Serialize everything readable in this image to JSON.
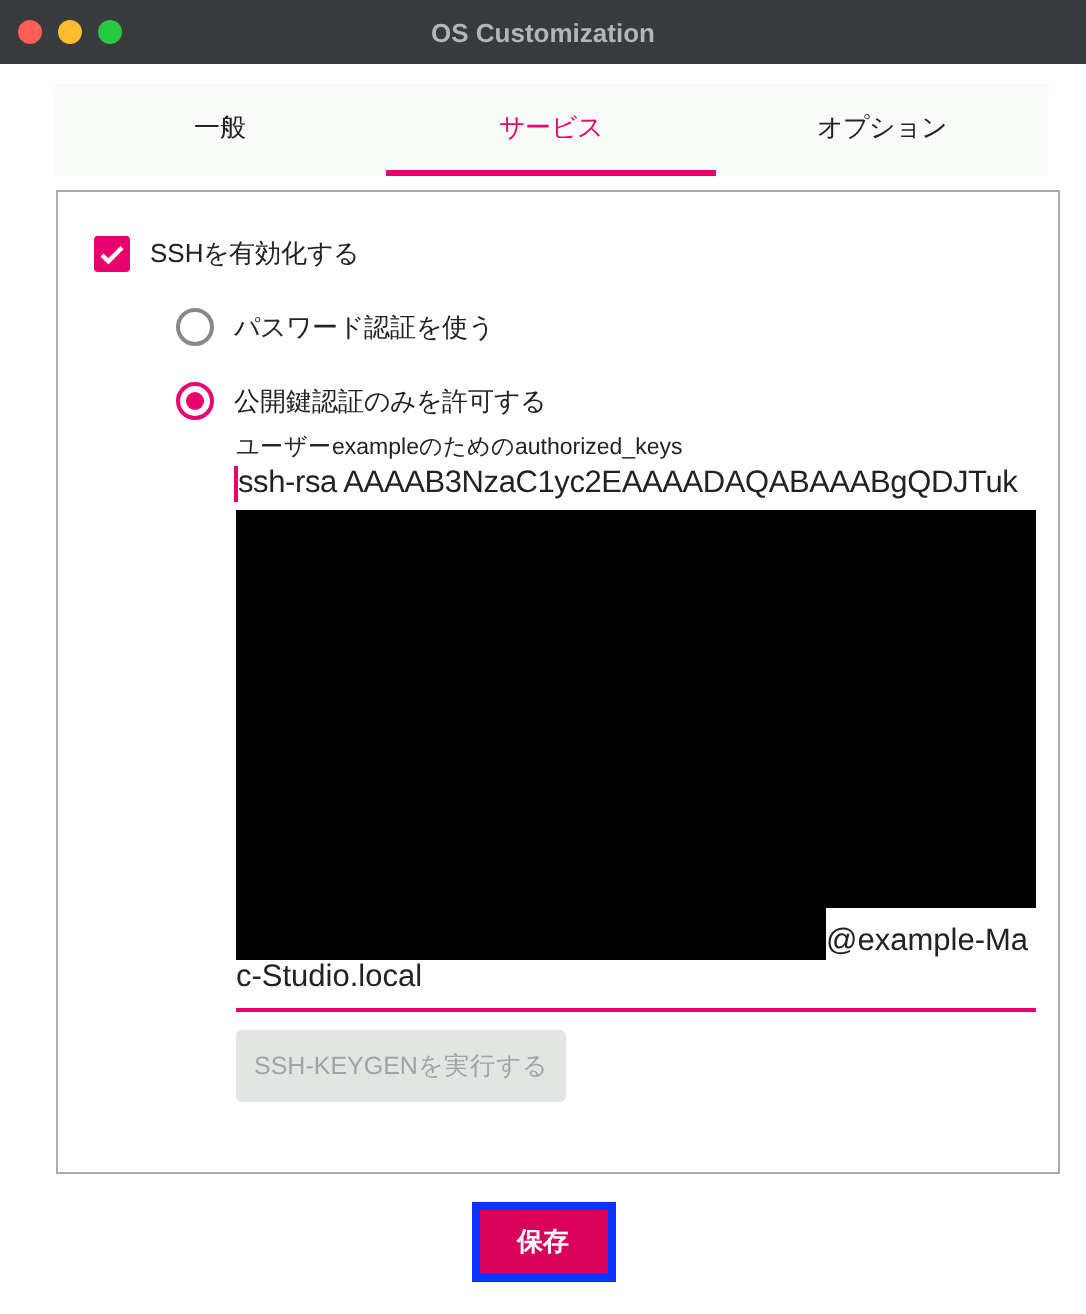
{
  "window": {
    "title": "OS Customization"
  },
  "tabs": [
    {
      "label": "一般",
      "selected": false
    },
    {
      "label": "サービス",
      "selected": true
    },
    {
      "label": "オプション",
      "selected": false
    }
  ],
  "ssh": {
    "label": "SSHを有効化する",
    "checked": true
  },
  "auth_options": [
    {
      "label": "パスワード認証を使う",
      "selected": false
    },
    {
      "label": "公開鍵認証のみを許可する",
      "selected": true
    }
  ],
  "keys_field": {
    "label": "ユーザーexampleのためのauthorized_keys",
    "first_line": "ssh-rsa AAAAB3NzaC1yc2EAAAADAQABAAABgQDJTuk",
    "after_redaction": "@example-Ma",
    "last_line": "c-Studio.local",
    "redacted": true
  },
  "keygen_button": {
    "label": "SSH-KEYGENを実行する",
    "disabled": true
  },
  "save_button": {
    "label": "保存",
    "focused": true
  }
}
